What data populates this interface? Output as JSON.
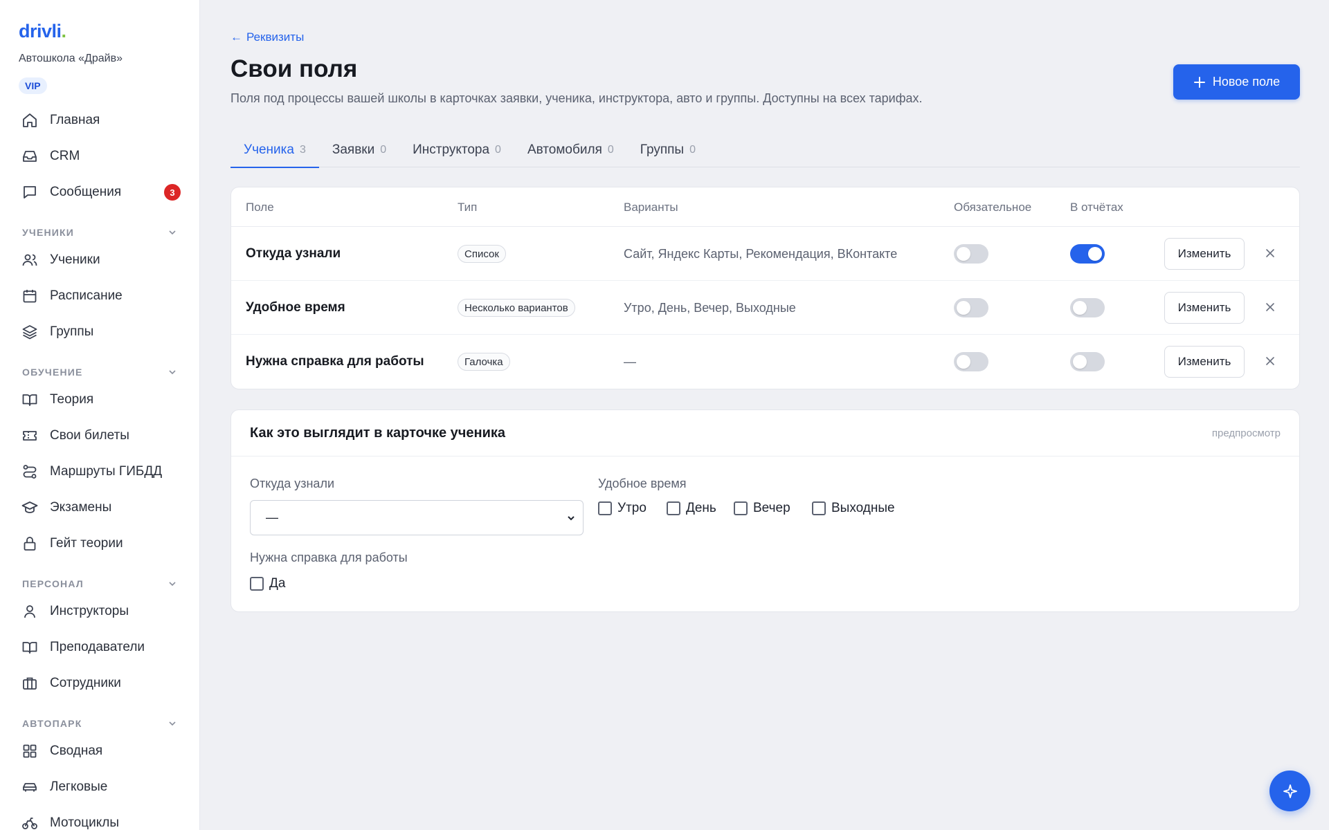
{
  "brand": {
    "logo_text": "drivli",
    "logo_dot": ".",
    "school": "Автошкола «Драйв»",
    "plan_badge": "VIP"
  },
  "sidebar": {
    "top_items": [
      {
        "label": "Главная",
        "icon": "home-icon"
      },
      {
        "label": "CRM",
        "icon": "inbox-icon"
      },
      {
        "label": "Сообщения",
        "icon": "message-icon",
        "badge": "3"
      }
    ],
    "sections": [
      {
        "title": "УЧЕНИКИ",
        "items": [
          {
            "label": "Ученики",
            "icon": "users-icon"
          },
          {
            "label": "Расписание",
            "icon": "calendar-icon"
          },
          {
            "label": "Группы",
            "icon": "layers-icon"
          }
        ]
      },
      {
        "title": "ОБУЧЕНИЕ",
        "items": [
          {
            "label": "Теория",
            "icon": "book-icon"
          },
          {
            "label": "Свои билеты",
            "icon": "ticket-icon"
          },
          {
            "label": "Маршруты ГИБДД",
            "icon": "route-icon"
          },
          {
            "label": "Экзамены",
            "icon": "graduation-cap-icon"
          },
          {
            "label": "Гейт теории",
            "icon": "lock-icon"
          }
        ]
      },
      {
        "title": "ПЕРСОНАЛ",
        "items": [
          {
            "label": "Инструкторы",
            "icon": "user-icon"
          },
          {
            "label": "Преподаватели",
            "icon": "book-open-icon"
          },
          {
            "label": "Сотрудники",
            "icon": "briefcase-icon"
          }
        ]
      },
      {
        "title": "АВТОПАРК",
        "items": [
          {
            "label": "Сводная",
            "icon": "grid-icon"
          },
          {
            "label": "Легковые",
            "icon": "car-icon"
          },
          {
            "label": "Мотоциклы",
            "icon": "bike-icon"
          }
        ]
      }
    ]
  },
  "header": {
    "back_label": "Реквизиты",
    "title": "Свои поля",
    "subtitle": "Поля под процессы вашей школы в карточках заявки, ученика, инструктора, авто и группы. Доступны на всех тарифах.",
    "new_field_label": "Новое поле"
  },
  "tabs": [
    {
      "label": "Ученика",
      "count": "3",
      "active": true
    },
    {
      "label": "Заявки",
      "count": "0"
    },
    {
      "label": "Инструктора",
      "count": "0"
    },
    {
      "label": "Автомобиля",
      "count": "0"
    },
    {
      "label": "Группы",
      "count": "0"
    }
  ],
  "table": {
    "headers": {
      "field": "Поле",
      "type": "Тип",
      "variants": "Варианты",
      "required": "Обязательное",
      "in_reports": "В отчётах"
    },
    "edit_label": "Изменить",
    "rows": [
      {
        "name": "Откуда узнали",
        "type": "Список",
        "variants": "Сайт, Яндекс Карты, Рекомендация, ВКонтакте",
        "required": false,
        "in_reports": true
      },
      {
        "name": "Удобное время",
        "type": "Несколько вариантов",
        "variants": "Утро, День, Вечер, Выходные",
        "required": false,
        "in_reports": false
      },
      {
        "name": "Нужна справка для работы",
        "type": "Галочка",
        "variants": "—",
        "required": false,
        "in_reports": false
      }
    ]
  },
  "preview": {
    "title": "Как это выглядит в карточке ученика",
    "tag": "предпросмотр",
    "source_label": "Откуда узнали",
    "source_value": "—",
    "time_label": "Удобное время",
    "time_options": [
      "Утро",
      "День",
      "Вечер",
      "Выходные"
    ],
    "certificate_label": "Нужна справка для работы",
    "certificate_option": "Да"
  },
  "colors": {
    "accent": "#2563eb",
    "badge": "#dc2626",
    "background": "#eff0f4"
  }
}
